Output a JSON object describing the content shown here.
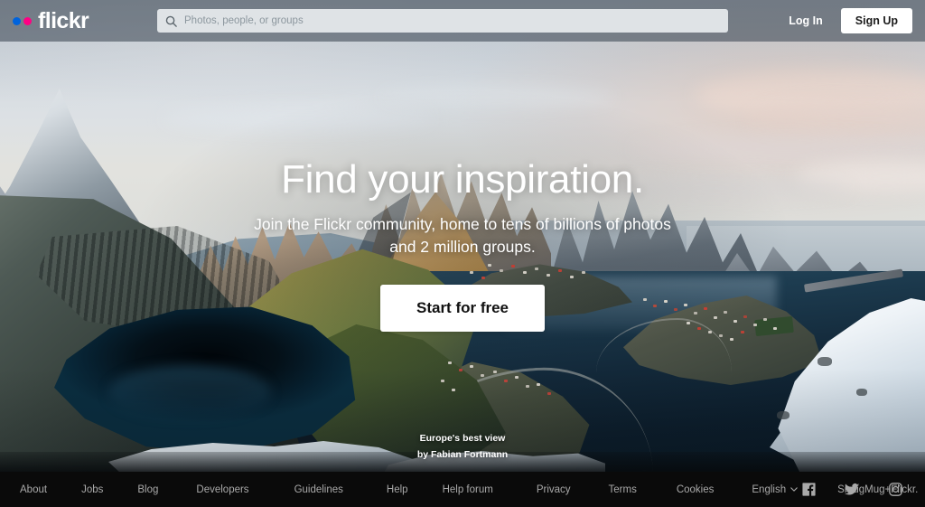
{
  "header": {
    "logo": {
      "text": "flickr",
      "dot1_color": "#0063dc",
      "dot2_color": "#ff0084"
    },
    "search": {
      "placeholder": "Photos, people, or groups",
      "value": "",
      "icon": "search-icon"
    },
    "login_label": "Log In",
    "signup_label": "Sign Up"
  },
  "hero": {
    "title": "Find your inspiration.",
    "subtitle": "Join the Flickr community, home to tens of billions of photos and 2 million groups.",
    "cta_label": "Start for free",
    "photo_title": "Europe's best view",
    "photo_author": "by Fabian Fortmann"
  },
  "footer": {
    "links": [
      {
        "label": "About"
      },
      {
        "label": "Jobs"
      },
      {
        "label": "Blog"
      },
      {
        "label": "Developers"
      },
      {
        "label": "Guidelines"
      },
      {
        "label": "Help"
      },
      {
        "label": "Help forum"
      },
      {
        "label": "Privacy"
      },
      {
        "label": "Terms"
      },
      {
        "label": "Cookies"
      },
      {
        "label": "English",
        "has_chevron": true
      },
      {
        "label": "SmugMug+Flickr."
      }
    ],
    "social": [
      {
        "name": "facebook-icon"
      },
      {
        "name": "twitter-icon"
      },
      {
        "name": "instagram-icon"
      }
    ],
    "background_color": "#0a0a0a",
    "link_color": "#a9a9a9"
  }
}
